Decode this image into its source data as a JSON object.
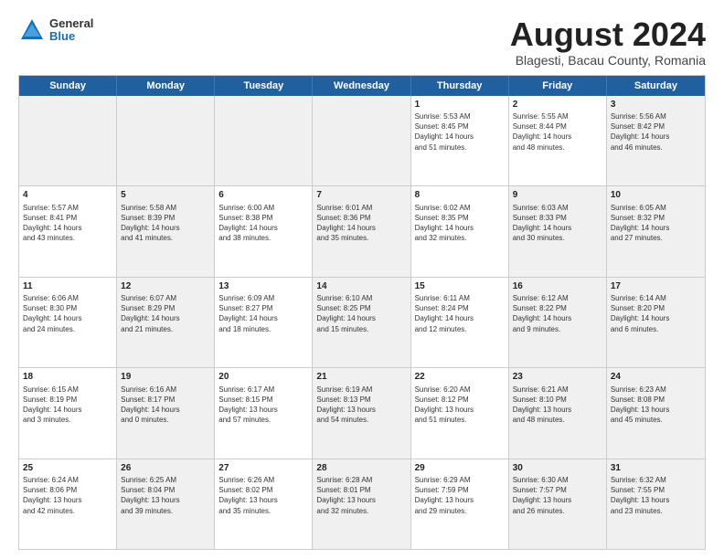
{
  "logo": {
    "general": "General",
    "blue": "Blue"
  },
  "title": "August 2024",
  "subtitle": "Blagesti, Bacau County, Romania",
  "header_days": [
    "Sunday",
    "Monday",
    "Tuesday",
    "Wednesday",
    "Thursday",
    "Friday",
    "Saturday"
  ],
  "weeks": [
    [
      {
        "day": "",
        "info": "",
        "shaded": true
      },
      {
        "day": "",
        "info": "",
        "shaded": true
      },
      {
        "day": "",
        "info": "",
        "shaded": true
      },
      {
        "day": "",
        "info": "",
        "shaded": true
      },
      {
        "day": "1",
        "info": "Sunrise: 5:53 AM\nSunset: 8:45 PM\nDaylight: 14 hours\nand 51 minutes."
      },
      {
        "day": "2",
        "info": "Sunrise: 5:55 AM\nSunset: 8:44 PM\nDaylight: 14 hours\nand 48 minutes."
      },
      {
        "day": "3",
        "info": "Sunrise: 5:56 AM\nSunset: 8:42 PM\nDaylight: 14 hours\nand 46 minutes.",
        "shaded": true
      }
    ],
    [
      {
        "day": "4",
        "info": "Sunrise: 5:57 AM\nSunset: 8:41 PM\nDaylight: 14 hours\nand 43 minutes."
      },
      {
        "day": "5",
        "info": "Sunrise: 5:58 AM\nSunset: 8:39 PM\nDaylight: 14 hours\nand 41 minutes.",
        "shaded": true
      },
      {
        "day": "6",
        "info": "Sunrise: 6:00 AM\nSunset: 8:38 PM\nDaylight: 14 hours\nand 38 minutes."
      },
      {
        "day": "7",
        "info": "Sunrise: 6:01 AM\nSunset: 8:36 PM\nDaylight: 14 hours\nand 35 minutes.",
        "shaded": true
      },
      {
        "day": "8",
        "info": "Sunrise: 6:02 AM\nSunset: 8:35 PM\nDaylight: 14 hours\nand 32 minutes."
      },
      {
        "day": "9",
        "info": "Sunrise: 6:03 AM\nSunset: 8:33 PM\nDaylight: 14 hours\nand 30 minutes.",
        "shaded": true
      },
      {
        "day": "10",
        "info": "Sunrise: 6:05 AM\nSunset: 8:32 PM\nDaylight: 14 hours\nand 27 minutes.",
        "shaded": true
      }
    ],
    [
      {
        "day": "11",
        "info": "Sunrise: 6:06 AM\nSunset: 8:30 PM\nDaylight: 14 hours\nand 24 minutes."
      },
      {
        "day": "12",
        "info": "Sunrise: 6:07 AM\nSunset: 8:29 PM\nDaylight: 14 hours\nand 21 minutes.",
        "shaded": true
      },
      {
        "day": "13",
        "info": "Sunrise: 6:09 AM\nSunset: 8:27 PM\nDaylight: 14 hours\nand 18 minutes."
      },
      {
        "day": "14",
        "info": "Sunrise: 6:10 AM\nSunset: 8:25 PM\nDaylight: 14 hours\nand 15 minutes.",
        "shaded": true
      },
      {
        "day": "15",
        "info": "Sunrise: 6:11 AM\nSunset: 8:24 PM\nDaylight: 14 hours\nand 12 minutes."
      },
      {
        "day": "16",
        "info": "Sunrise: 6:12 AM\nSunset: 8:22 PM\nDaylight: 14 hours\nand 9 minutes.",
        "shaded": true
      },
      {
        "day": "17",
        "info": "Sunrise: 6:14 AM\nSunset: 8:20 PM\nDaylight: 14 hours\nand 6 minutes.",
        "shaded": true
      }
    ],
    [
      {
        "day": "18",
        "info": "Sunrise: 6:15 AM\nSunset: 8:19 PM\nDaylight: 14 hours\nand 3 minutes."
      },
      {
        "day": "19",
        "info": "Sunrise: 6:16 AM\nSunset: 8:17 PM\nDaylight: 14 hours\nand 0 minutes.",
        "shaded": true
      },
      {
        "day": "20",
        "info": "Sunrise: 6:17 AM\nSunset: 8:15 PM\nDaylight: 13 hours\nand 57 minutes."
      },
      {
        "day": "21",
        "info": "Sunrise: 6:19 AM\nSunset: 8:13 PM\nDaylight: 13 hours\nand 54 minutes.",
        "shaded": true
      },
      {
        "day": "22",
        "info": "Sunrise: 6:20 AM\nSunset: 8:12 PM\nDaylight: 13 hours\nand 51 minutes."
      },
      {
        "day": "23",
        "info": "Sunrise: 6:21 AM\nSunset: 8:10 PM\nDaylight: 13 hours\nand 48 minutes.",
        "shaded": true
      },
      {
        "day": "24",
        "info": "Sunrise: 6:23 AM\nSunset: 8:08 PM\nDaylight: 13 hours\nand 45 minutes.",
        "shaded": true
      }
    ],
    [
      {
        "day": "25",
        "info": "Sunrise: 6:24 AM\nSunset: 8:06 PM\nDaylight: 13 hours\nand 42 minutes."
      },
      {
        "day": "26",
        "info": "Sunrise: 6:25 AM\nSunset: 8:04 PM\nDaylight: 13 hours\nand 39 minutes.",
        "shaded": true
      },
      {
        "day": "27",
        "info": "Sunrise: 6:26 AM\nSunset: 8:02 PM\nDaylight: 13 hours\nand 35 minutes."
      },
      {
        "day": "28",
        "info": "Sunrise: 6:28 AM\nSunset: 8:01 PM\nDaylight: 13 hours\nand 32 minutes.",
        "shaded": true
      },
      {
        "day": "29",
        "info": "Sunrise: 6:29 AM\nSunset: 7:59 PM\nDaylight: 13 hours\nand 29 minutes."
      },
      {
        "day": "30",
        "info": "Sunrise: 6:30 AM\nSunset: 7:57 PM\nDaylight: 13 hours\nand 26 minutes.",
        "shaded": true
      },
      {
        "day": "31",
        "info": "Sunrise: 6:32 AM\nSunset: 7:55 PM\nDaylight: 13 hours\nand 23 minutes.",
        "shaded": true
      }
    ]
  ]
}
